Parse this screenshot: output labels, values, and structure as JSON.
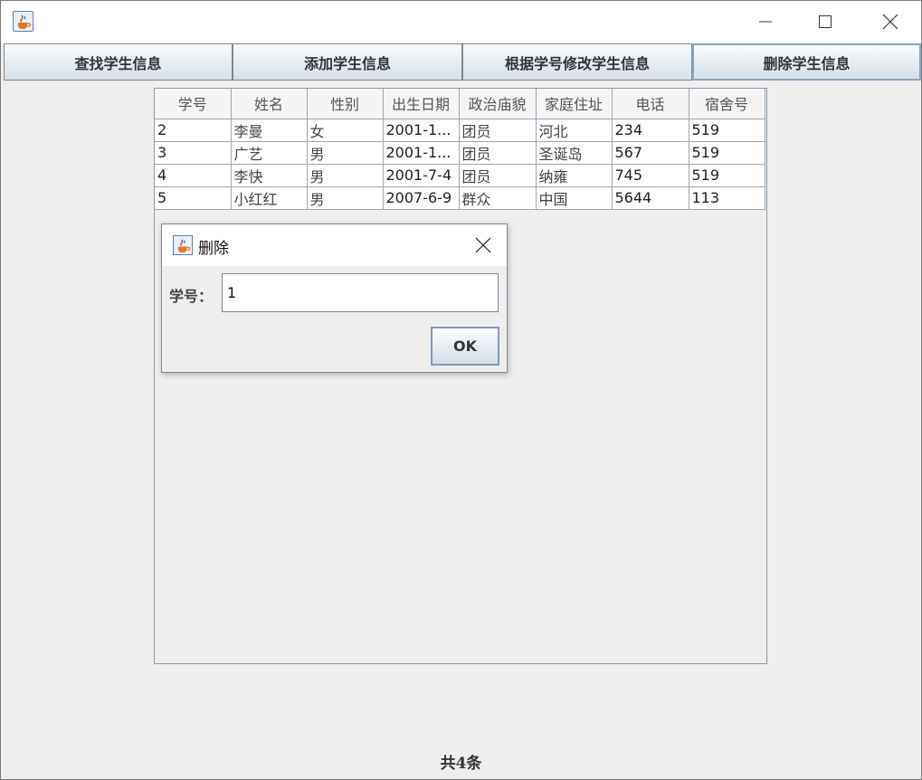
{
  "window": {
    "title": "",
    "icon": "java-cup-icon",
    "controls": {
      "minimize": "minimize-icon",
      "maximize": "maximize-icon",
      "close": "close-icon"
    }
  },
  "toolbar": {
    "buttons": [
      {
        "label": "查找学生信息"
      },
      {
        "label": "添加学生信息"
      },
      {
        "label": "根据学号修改学生信息"
      },
      {
        "label": "删除学生信息"
      }
    ]
  },
  "table": {
    "columns": [
      "学号",
      "姓名",
      "性别",
      "出生日期",
      "政治庙貌",
      "家庭住址",
      "电话",
      "宿舍号"
    ],
    "rows": [
      [
        "2",
        "李曼",
        "女",
        "2001-1...",
        "团员",
        "河北",
        "234",
        "519"
      ],
      [
        "3",
        "广艺",
        "男",
        "2001-1...",
        "团员",
        "圣诞岛",
        "567",
        "519"
      ],
      [
        "4",
        "李快",
        "男",
        "2001-7-4",
        "团员",
        "纳雍",
        "745",
        "519"
      ],
      [
        "5",
        "小红红",
        "男",
        "2007-6-9",
        "群众",
        "中国",
        "5644",
        "113"
      ]
    ]
  },
  "dialog": {
    "title": "删除",
    "field_label": "学号：",
    "field_value": "1",
    "ok_label": "OK"
  },
  "status": {
    "text": "共4条"
  }
}
